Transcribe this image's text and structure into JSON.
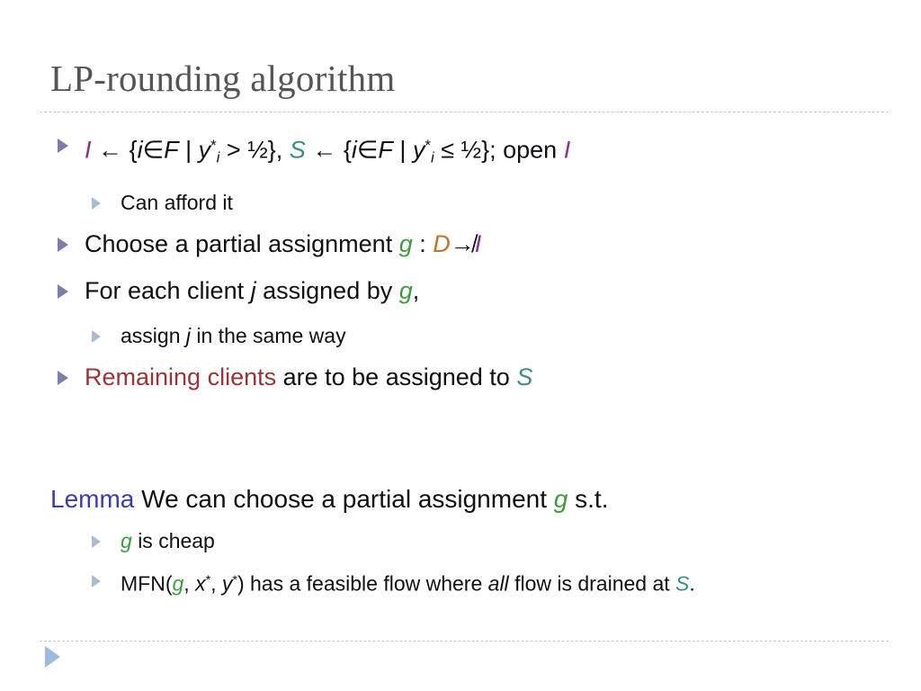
{
  "slide": {
    "title": "LP-rounding algorithm",
    "background_color": "#ffffff",
    "title_color": "#555558"
  },
  "colors": {
    "set_I": "#8f2c90",
    "set_S": "#3d8d85",
    "assignment_g": "#3f9b3f",
    "set_D": "#c3712f",
    "remaining_clients": "#9a3437",
    "lemma": "#3b3cae",
    "bullet_level1": "#7d7da8",
    "bullet_level2": "#a9bcd1",
    "footer_triangle": "#9cbcdd",
    "divider": "#c9c9cd",
    "body_text": "#101014"
  },
  "bullets": [
    {
      "level": 1,
      "plain_text": "I ← {i∈F | y*i > ½}, S ← {i∈F | y*i ≤ ½}; open I",
      "parts": {
        "set_i_1": "I",
        "arrow_1": "←",
        "brace_open_1": "{",
        "member_i_1": "i",
        "in_1": "∈",
        "set_f_1": "F",
        "bar_1": "|",
        "y_1": "y",
        "star_1": "*",
        "sub_i_1": "i",
        "gt": ">",
        "half_1": "½",
        "brace_close_1": "},",
        "set_s": "S",
        "arrow_2": "←",
        "brace_open_2": "{",
        "member_i_2": "i",
        "in_2": "∈",
        "set_f_2": "F",
        "bar_2": "|",
        "y_2": "y",
        "star_2": "*",
        "sub_i_2": "i",
        "leq": "≤",
        "half_2": "½",
        "brace_close_2": "};",
        "open_word": "open",
        "set_i_2": "I"
      }
    },
    {
      "level": 2,
      "plain_text": "Can afford it",
      "parts": {
        "text": "Can afford it"
      }
    },
    {
      "level": 1,
      "plain_text": "Choose a partial assignment g : D↛I",
      "parts": {
        "lead": "Choose a partial assignment",
        "g": "g",
        "colon": ":",
        "d": "D",
        "partial_arrow": "↛",
        "i": "I"
      }
    },
    {
      "level": 1,
      "plain_text": "For each client j assigned by g,",
      "parts": {
        "lead": "For each client",
        "j": "j",
        "mid": "assigned by",
        "g": "g",
        "comma": ","
      }
    },
    {
      "level": 2,
      "plain_text": "assign j in the same way",
      "parts": {
        "lead": "assign",
        "j": "j",
        "tail": "in the same way"
      }
    },
    {
      "level": 1,
      "plain_text": "Remaining clients are to be assigned to S",
      "parts": {
        "remaining": "Remaining clients",
        "mid": "are to be assigned to",
        "s": "S"
      }
    }
  ],
  "lemma": {
    "label": "Lemma",
    "statement_lead": "We can choose a partial assignment",
    "g": "g",
    "statement_tail": "s.t.",
    "items": [
      {
        "plain_text": "g is cheap",
        "parts": {
          "g": "g",
          "text": "is cheap"
        }
      },
      {
        "plain_text": "MFN(g, x*, y*) has a feasible flow where all flow is drained at S.",
        "parts": {
          "mfn_open": "MFN(",
          "g": "g",
          "comma_1": ",",
          "x": "x",
          "star_x": "*",
          "comma_2": ",",
          "y": "y",
          "star_y": "*",
          "close": ")",
          "mid": "has a feasible flow where",
          "all": "all",
          "tail": "flow is drained at",
          "s": "S",
          "period": "."
        }
      }
    ]
  },
  "footer": {
    "advance_marker": "play-triangle"
  }
}
